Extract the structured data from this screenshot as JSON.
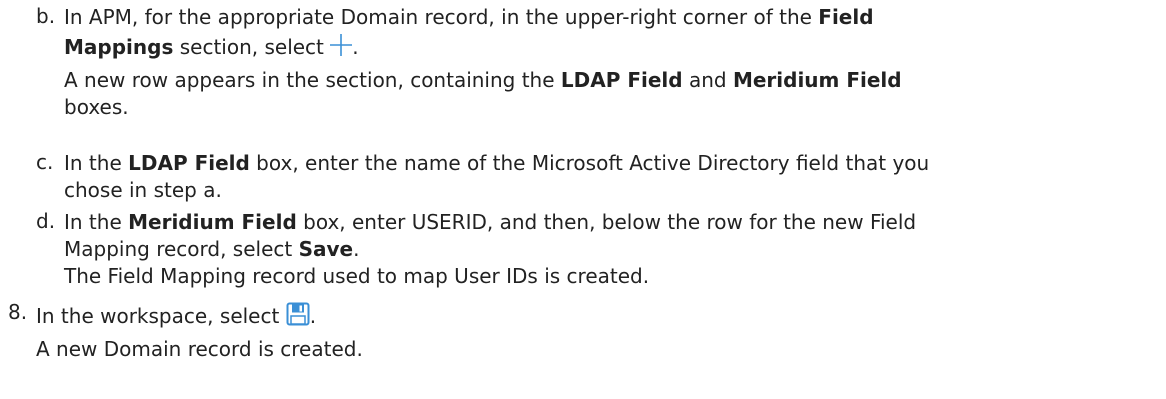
{
  "substeps": {
    "b": {
      "marker": "b.",
      "l1_a": "In APM, for the appropriate Domain record, in the upper-right corner of the ",
      "l1_b": "Field",
      "l2_a": "Mappings",
      "l2_b": " section, select ",
      "l2_c": ".",
      "l2_icon": "plus-icon",
      "l3_a": "A new row appears in the section, containing the ",
      "l3_b": "LDAP Field",
      "l3_c": " and ",
      "l3_d": "Meridium Field",
      "l4_a": "boxes."
    },
    "c": {
      "marker": "c.",
      "l1_a": "In the ",
      "l1_b": "LDAP Field",
      "l1_c": " box, enter the name of the Microsoft Active Directory field that you",
      "l2_a": "chose in step a."
    },
    "d": {
      "marker": "d.",
      "l1_a": "In the ",
      "l1_b": "Meridium Field",
      "l1_c": " box, enter USERID, and then, below the row for the new Field",
      "l2_a": "Mapping record, select ",
      "l2_b": "Save",
      "l2_c": ".",
      "l3_a": "The Field Mapping record used to map User IDs is created."
    }
  },
  "step8": {
    "marker": "8.",
    "l1_a": "In the workspace, select ",
    "l1_b": ".",
    "l1_icon": "save-icon",
    "l2_a": "A new Domain record is created."
  },
  "colors": {
    "text": "#222222",
    "icon_blue": "#3a8fd6"
  }
}
